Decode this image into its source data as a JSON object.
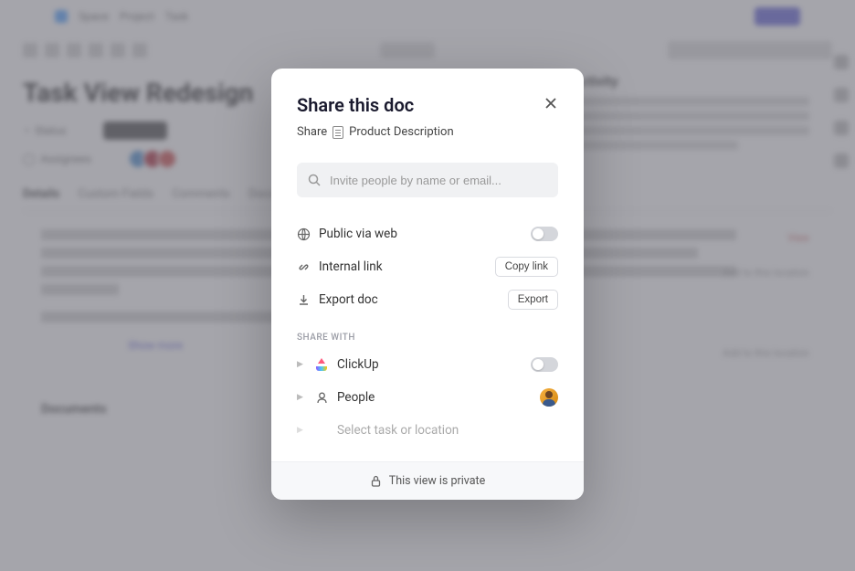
{
  "bg": {
    "header_items": [
      "Space",
      "Project",
      "Task"
    ],
    "title": "Task View Redesign",
    "meta_status": "Status",
    "meta_assignee": "Assignees",
    "tabs": [
      "Details",
      "Custom Fields",
      "Comments",
      "Docs"
    ],
    "section_docs": "Documents"
  },
  "modal": {
    "title": "Share this doc",
    "subtitle_prefix": "Share",
    "doc_name": "Product Description",
    "search_placeholder": "Invite people by name or email...",
    "options": {
      "public": "Public via web",
      "internal": "Internal link",
      "export": "Export doc",
      "copy_link_btn": "Copy link",
      "export_btn": "Export"
    },
    "share_with_label": "SHARE WITH",
    "share_items": {
      "clickup": "ClickUp",
      "people": "People",
      "select_task": "Select task or location"
    },
    "footer": "This view is private"
  }
}
